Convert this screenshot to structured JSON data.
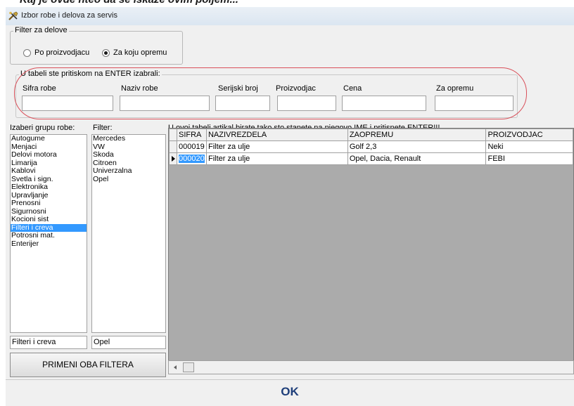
{
  "background_strip": "Kaj je ovde hteo da se iskaze ovim poljem...",
  "window": {
    "title": "Izbor robe i delova za servis"
  },
  "filter_group": {
    "legend": "Filter za delove",
    "option1": "Po proizvodjacu",
    "option2": "Za koju opremu",
    "selected": "Za koju opremu"
  },
  "selection_group": {
    "legend": "U tabeli ste pritiskom na ENTER izabrali:",
    "fields": {
      "sifra": "Sifra robe",
      "naziv": "Naziv robe",
      "serijski": "Serijski broj",
      "proizvodjac": "Proizvodjac",
      "cena": "Cena",
      "oprema": "Za opremu"
    }
  },
  "groups": {
    "label": "Izaberi grupu robe:",
    "items": [
      "Autogume",
      "Menjaci",
      "Delovi motora",
      "Limarija",
      "Kablovi",
      "Svetla i sign.",
      "Elektronika",
      "Upravljanje",
      "Prenosni",
      "Sigurnosni",
      "Kocioni sist",
      "Filteri i creva",
      "Potrosni mat.",
      "Enterijer"
    ],
    "selected": "Filteri i creva"
  },
  "filter": {
    "label": "Filter:",
    "items": [
      "Mercedes",
      "VW",
      "Skoda",
      "Citroen",
      "Univerzalna",
      "Opel"
    ],
    "selected": "Opel"
  },
  "apply_button": "PRIMENI OBA FILTERA",
  "grid": {
    "instruction": "U ovoj tabeli artikal birate tako sto stanete na njegovo IME i pritisnete ENTER!!!",
    "columns": [
      "SIFRA",
      "NAZIVREZDELA",
      "ZAOPREMU",
      "PROIZVODJAC"
    ],
    "rows": [
      [
        "000019",
        "Filter za ulje",
        "Golf 2,3",
        "Neki"
      ],
      [
        "000020",
        "Filter za ulje",
        "Opel, Dacia, Renault",
        "FEBI"
      ]
    ],
    "current_row": 1
  },
  "ok_button": "OK",
  "colors": {
    "selection": "#3399ff",
    "oval": "#d9505a",
    "ok_text": "#1f3f7a"
  },
  "icons": {
    "title": "tools-icon",
    "row_pointer": "triangle-right-icon",
    "scroll_left": "arrow-left-icon"
  }
}
